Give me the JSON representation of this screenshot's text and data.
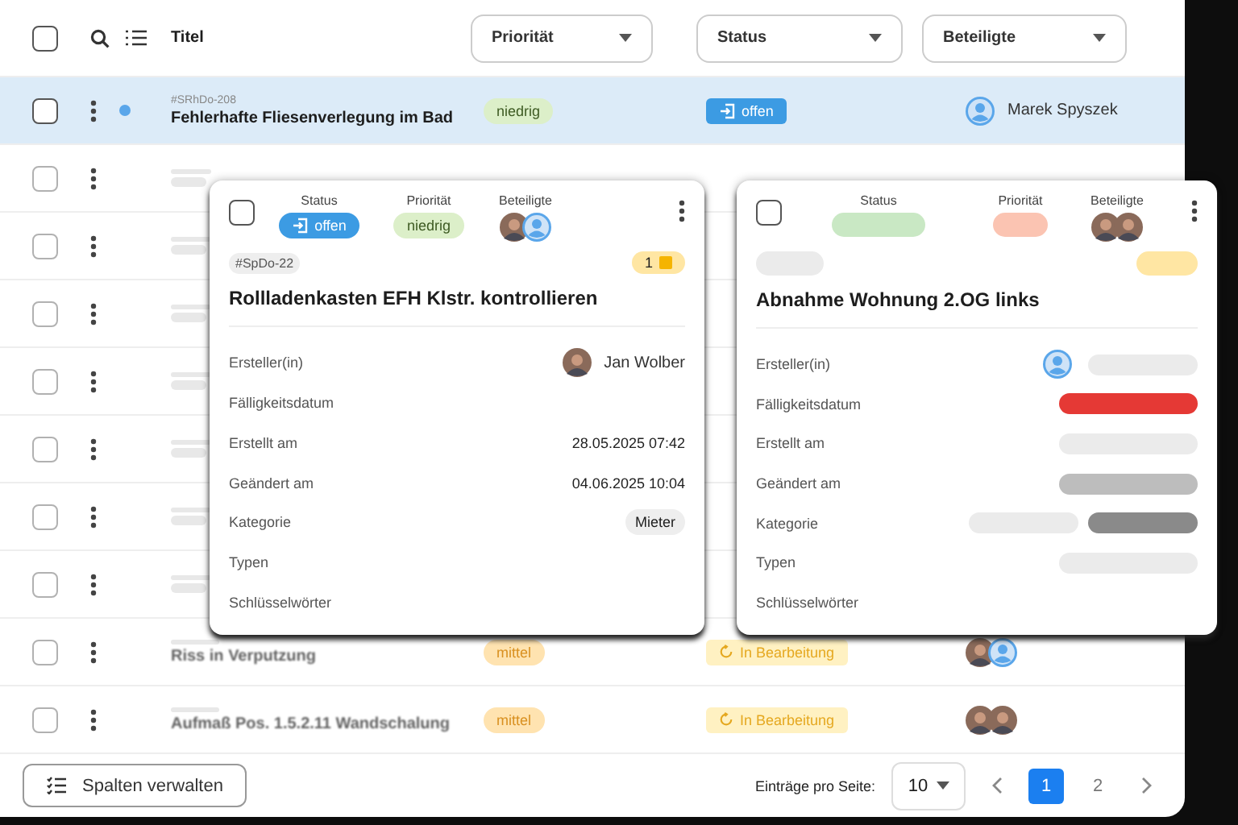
{
  "header": {
    "select_all_checked": false,
    "title_label": "Titel",
    "filters": [
      {
        "label": "Priorität"
      },
      {
        "label": "Status"
      },
      {
        "label": "Beteiligte"
      }
    ]
  },
  "rows": [
    {
      "kind": "full",
      "checked": false,
      "selected": true,
      "unread": true,
      "id": "#SRhDo-208",
      "title": "Fehlerhafte Fliesenverlegung im Bad",
      "priority": {
        "label": "niedrig",
        "color": "#dcefc9"
      },
      "status": {
        "label": "offen",
        "color": "#3c9be3"
      },
      "people": [
        {
          "kind": "user"
        }
      ],
      "person_name": "Marek Spyszek"
    },
    {
      "kind": "covered",
      "checked": false,
      "selected": false,
      "unread": false
    },
    {
      "kind": "covered",
      "checked": false,
      "selected": false,
      "unread": false
    },
    {
      "kind": "covered",
      "checked": false,
      "selected": false,
      "unread": false
    },
    {
      "kind": "covered",
      "checked": false,
      "selected": false,
      "unread": false
    },
    {
      "kind": "covered",
      "checked": false,
      "selected": false,
      "unread": false
    },
    {
      "kind": "covered",
      "checked": false,
      "selected": false,
      "unread": false
    },
    {
      "kind": "covered",
      "checked": false,
      "selected": false,
      "unread": false
    },
    {
      "kind": "full",
      "checked": false,
      "selected": false,
      "unread": false,
      "title": "Riss in Verputzung",
      "priority": {
        "label": "mittel",
        "color": "#ffe3b0"
      },
      "status": {
        "label": "In Bearbeitung",
        "color": "#fff1c2"
      },
      "people": [
        {
          "kind": "photo"
        },
        {
          "kind": "user"
        }
      ]
    },
    {
      "kind": "full",
      "checked": false,
      "selected": false,
      "unread": false,
      "title": "Aufmaß Pos. 1.5.2.11 Wandschalung",
      "priority": {
        "label": "mittel",
        "color": "#ffe3b0"
      },
      "status": {
        "label": "In Bearbeitung",
        "color": "#fff1c2"
      },
      "people": [
        {
          "kind": "photo"
        },
        {
          "kind": "photo"
        }
      ]
    }
  ],
  "cards": [
    {
      "kind": "loaded",
      "checked": false,
      "status_label": "Status",
      "priority_label": "Priorität",
      "people_label": "Beteiligte",
      "status": {
        "label": "offen",
        "color": "#3c9be3"
      },
      "priority": {
        "label": "niedrig",
        "color": "#dcefc9"
      },
      "people": [
        {
          "kind": "photo"
        },
        {
          "kind": "user"
        }
      ],
      "tag": "#SpDo-22",
      "count": "1",
      "title": "Rollladenkasten EFH Klstr. kontrollieren",
      "fields": [
        {
          "label": "Ersteller(in)",
          "kind": "person",
          "value": "Jan Wolber"
        },
        {
          "label": "Fälligkeitsdatum",
          "kind": "empty"
        },
        {
          "label": "Erstellt am",
          "kind": "text",
          "value": "28.05.2025 07:42"
        },
        {
          "label": "Geändert am",
          "kind": "text",
          "value": "04.06.2025 10:04"
        },
        {
          "label": "Kategorie",
          "kind": "chip",
          "value": "Mieter"
        },
        {
          "label": "Typen",
          "kind": "empty"
        },
        {
          "label": "Schlüsselwörter",
          "kind": "empty"
        }
      ]
    },
    {
      "kind": "loading",
      "checked": false,
      "status_label": "Status",
      "priority_label": "Priorität",
      "people_label": "Beteiligte",
      "status": {
        "color": "#c9e8c4"
      },
      "priority": {
        "color": "#fbc4b2"
      },
      "people": [
        {
          "kind": "photo"
        },
        {
          "kind": "photo"
        }
      ],
      "title": "Abnahme Wohnung 2.OG links",
      "fields": [
        {
          "label": "Ersteller(in)",
          "kind": "placeholder",
          "user": true,
          "bars": [
            {
              "color": "#ebebeb"
            }
          ]
        },
        {
          "label": "Fälligkeitsdatum",
          "kind": "placeholder",
          "bars": [
            {
              "color": "#e53935"
            }
          ]
        },
        {
          "label": "Erstellt am",
          "kind": "placeholder",
          "bars": [
            {
              "color": "#ebebeb"
            }
          ]
        },
        {
          "label": "Geändert am",
          "kind": "placeholder",
          "bars": [
            {
              "color": "#bdbdbd"
            }
          ]
        },
        {
          "label": "Kategorie",
          "kind": "placeholder",
          "bars": [
            {
              "color": "#ebebeb"
            },
            {
              "color": "#8a8a8a"
            }
          ]
        },
        {
          "label": "Typen",
          "kind": "placeholder",
          "bars": [
            {
              "color": "#ebebeb"
            }
          ]
        },
        {
          "label": "Schlüsselwörter",
          "kind": "empty"
        }
      ]
    }
  ],
  "footer": {
    "columns_button": "Spalten verwalten",
    "page_size_label": "Einträge pro Seite:",
    "page_size": "10",
    "pages": [
      {
        "label": "1",
        "selected": true
      },
      {
        "label": "2",
        "selected": false
      }
    ]
  }
}
